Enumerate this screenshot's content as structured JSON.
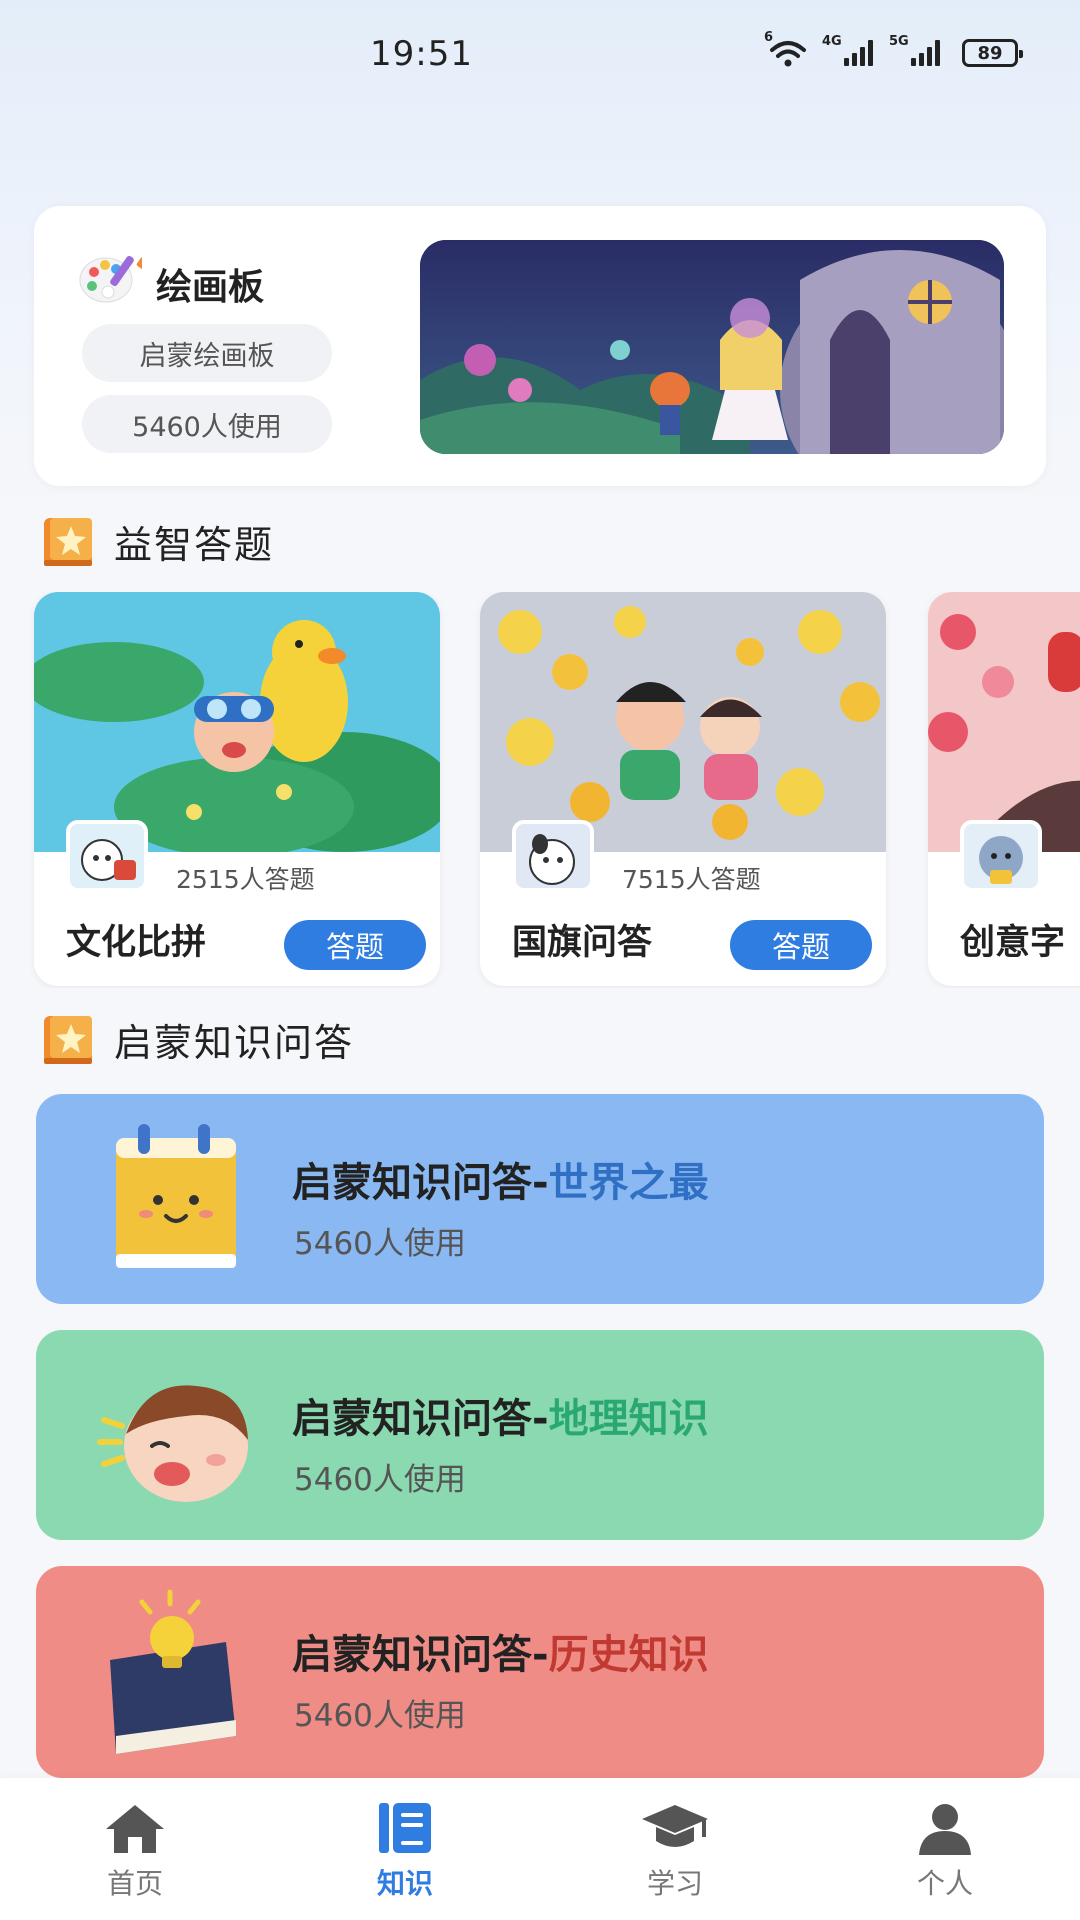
{
  "status_bar": {
    "time": "19:51",
    "wifi_tag": "6",
    "signal1_tag": "4G",
    "signal2_tag": "5G",
    "battery": "89"
  },
  "draw_board": {
    "icon": "palette-icon",
    "title": "绘画板",
    "tag": "启蒙绘画板",
    "users": "5460人使用"
  },
  "puzzle_section": {
    "title": "益智答题",
    "icon": "book-star-icon",
    "cards": [
      {
        "name": "文化比拼",
        "count": "2515人答题",
        "button": "答题"
      },
      {
        "name": "国旗问答",
        "count": "7515人答题",
        "button": "答题"
      },
      {
        "name": "创意字"
      }
    ]
  },
  "knowledge_section": {
    "title": "启蒙知识问答",
    "icon": "book-star-icon",
    "items": [
      {
        "prefix": "启蒙知识问答-",
        "topic": "世界之最",
        "users": "5460人使用",
        "bg": "#8ab8f2",
        "topic_color": "#2f6fc4"
      },
      {
        "prefix": "启蒙知识问答-",
        "topic": "地理知识",
        "users": "5460人使用",
        "bg": "#8ad9b0",
        "topic_color": "#2aa873"
      },
      {
        "prefix": "启蒙知识问答-",
        "topic": "历史知识",
        "users": "5460人使用",
        "bg": "#ef8c86",
        "topic_color": "#c03a32"
      }
    ]
  },
  "bottom_nav": {
    "items": [
      {
        "label": "首页",
        "icon": "home-icon",
        "active": false
      },
      {
        "label": "知识",
        "icon": "book-icon",
        "active": true
      },
      {
        "label": "学习",
        "icon": "graduation-cap-icon",
        "active": false
      },
      {
        "label": "个人",
        "icon": "person-icon",
        "active": false
      }
    ],
    "active_color": "#2f7de0"
  }
}
